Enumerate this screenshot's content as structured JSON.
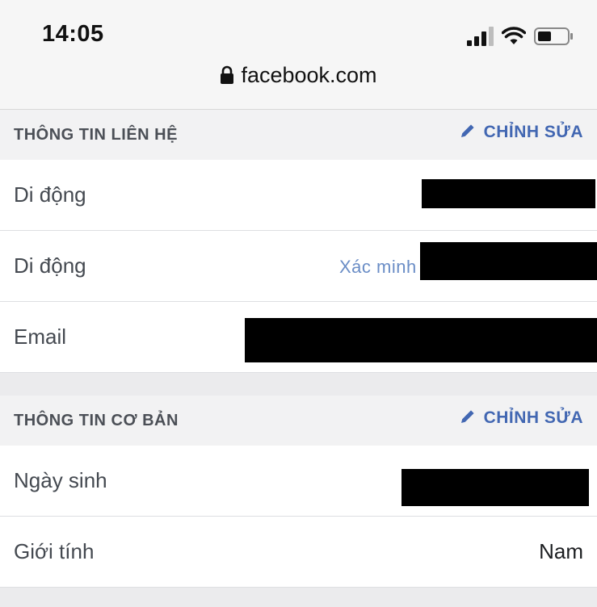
{
  "status_bar": {
    "time": "14:05",
    "url": "facebook.com"
  },
  "contact_section": {
    "title": "THÔNG TIN LIÊN HỆ",
    "edit_label": "CHỈNH SỬA",
    "rows": [
      {
        "label": "Di động"
      },
      {
        "label": "Di động",
        "verify_label": "Xác minh"
      },
      {
        "label": "Email"
      }
    ]
  },
  "basic_section": {
    "title": "THÔNG TIN CƠ BẢN",
    "edit_label": "CHỈNH SỬA",
    "rows": [
      {
        "label": "Ngày sinh"
      },
      {
        "label": "Giới tính",
        "value": "Nam"
      }
    ]
  },
  "colors": {
    "accent": "#4267b2",
    "section_bg": "#f2f2f3",
    "redaction": "#000000"
  },
  "icons": [
    "signal-icon",
    "wifi-icon",
    "battery-icon",
    "lock-icon",
    "pencil-icon"
  ]
}
